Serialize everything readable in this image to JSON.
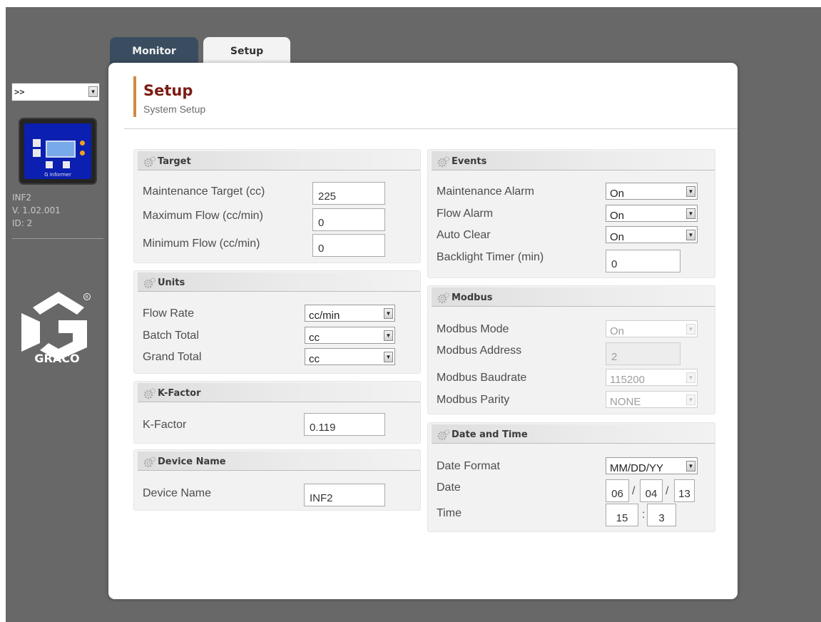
{
  "device_selector": {
    "value": ">>"
  },
  "device_info": {
    "name": "INF2",
    "version": "V. 1.02.001",
    "id": "ID: 2"
  },
  "device_thumb": {
    "brand": "G Informer"
  },
  "logo": {
    "text": "GRACO"
  },
  "tabs": {
    "monitor": "Monitor",
    "setup": "Setup"
  },
  "page": {
    "title": "Setup",
    "subtitle": "System Setup"
  },
  "sections": {
    "target": {
      "title": "Target",
      "maintenance_target_label": "Maintenance Target (cc)",
      "maintenance_target_value": "225",
      "maximum_flow_label": "Maximum Flow (cc/min)",
      "maximum_flow_value": "0",
      "minimum_flow_label": "Minimum Flow (cc/min)",
      "minimum_flow_value": "0"
    },
    "units": {
      "title": "Units",
      "flow_rate_label": "Flow Rate",
      "flow_rate_value": "cc/min",
      "batch_total_label": "Batch Total",
      "batch_total_value": "cc",
      "grand_total_label": "Grand Total",
      "grand_total_value": "cc"
    },
    "kfactor": {
      "title": "K-Factor",
      "label": "K-Factor",
      "value": "0.119"
    },
    "device_name": {
      "title": "Device Name",
      "label": "Device Name",
      "value": "INF2"
    },
    "events": {
      "title": "Events",
      "maintenance_alarm_label": "Maintenance Alarm",
      "maintenance_alarm_value": "On",
      "flow_alarm_label": "Flow Alarm",
      "flow_alarm_value": "On",
      "auto_clear_label": "Auto Clear",
      "auto_clear_value": "On",
      "backlight_label": "Backlight Timer (min)",
      "backlight_value": "0"
    },
    "modbus": {
      "title": "Modbus",
      "mode_label": "Modbus Mode",
      "mode_value": "On",
      "address_label": "Modbus Address",
      "address_value": "2",
      "baudrate_label": "Modbus Baudrate",
      "baudrate_value": "115200",
      "parity_label": "Modbus Parity",
      "parity_value": "NONE"
    },
    "datetime": {
      "title": "Date and Time",
      "format_label": "Date Format",
      "format_value": "MM/DD/YY",
      "date_label": "Date",
      "date_month": "06",
      "date_day": "04",
      "date_year": "13",
      "date_sep": "/",
      "time_label": "Time",
      "time_hour": "15",
      "time_minute": "3",
      "time_sep": ":"
    }
  },
  "colors": {
    "accent_bar": "#cf8a45",
    "title": "#7b1c14",
    "tab_active": "#3a4d60",
    "background": "#686868"
  }
}
